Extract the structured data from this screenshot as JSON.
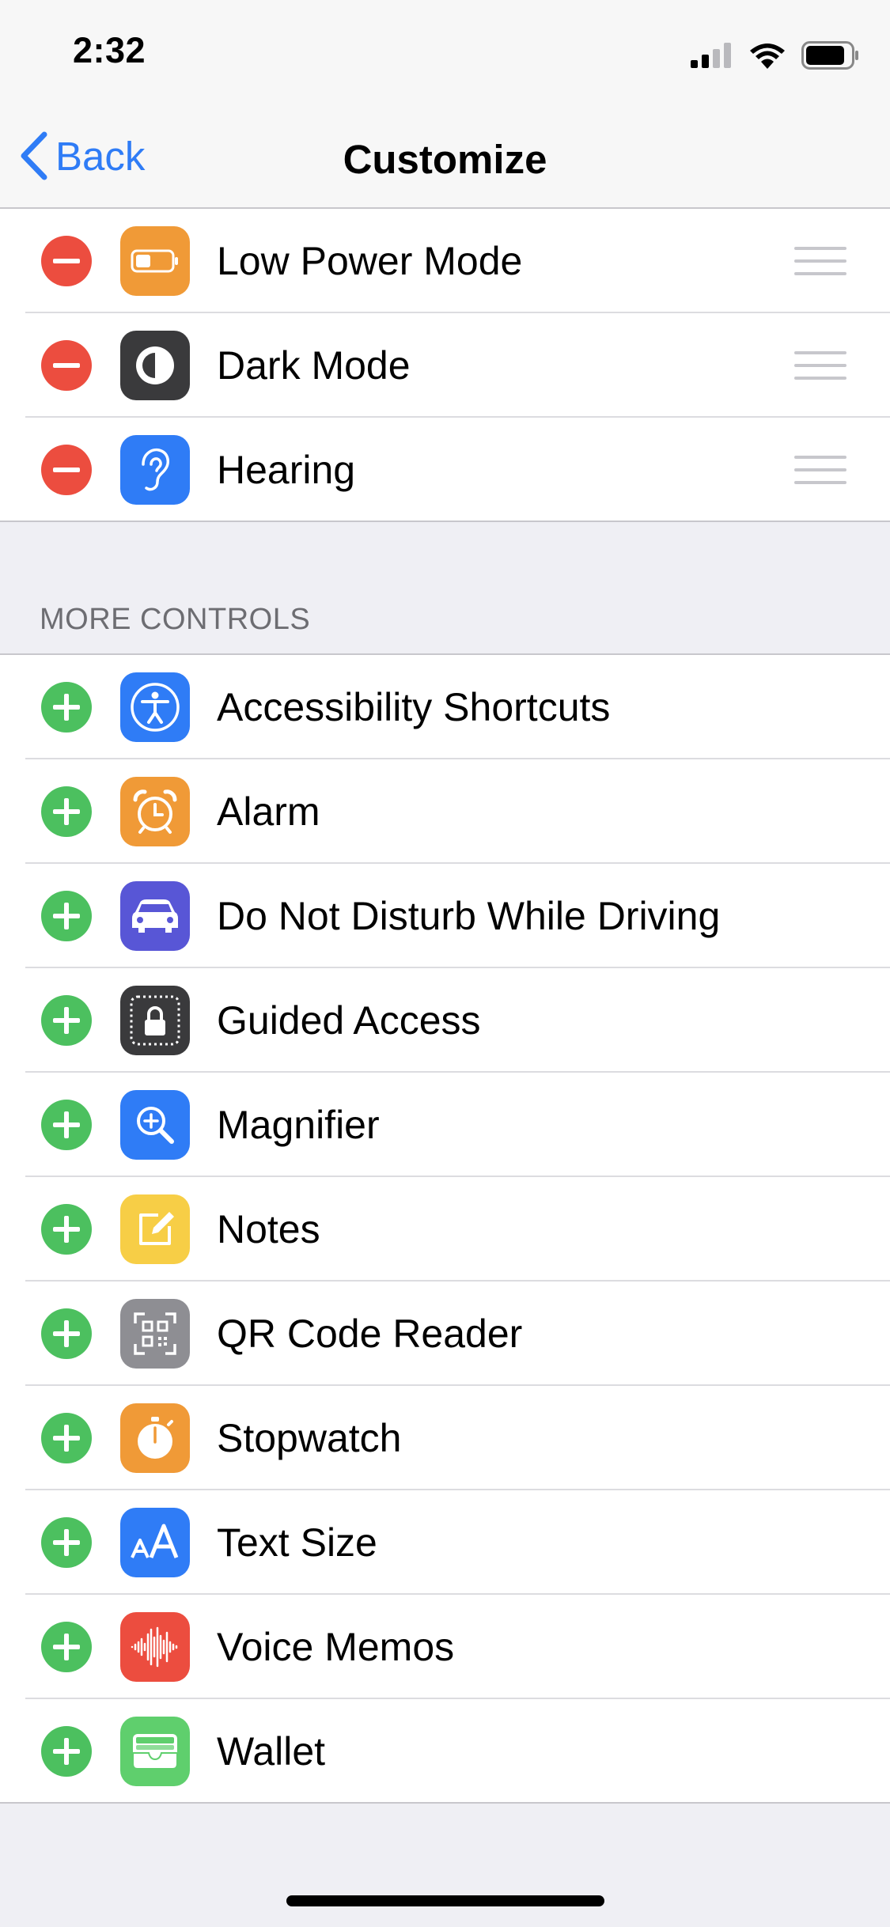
{
  "status": {
    "time": "2:32"
  },
  "nav": {
    "back_label": "Back",
    "title": "Customize"
  },
  "included": [
    {
      "label": "Low Power Mode",
      "icon": "battery-icon",
      "color": "#f09a37"
    },
    {
      "label": "Dark Mode",
      "icon": "dark-mode-icon",
      "color": "#3a3a3c"
    },
    {
      "label": "Hearing",
      "icon": "ear-icon",
      "color": "#2f7cf6"
    }
  ],
  "more_controls": {
    "header": "MORE CONTROLS",
    "items": [
      {
        "label": "Accessibility Shortcuts",
        "icon": "accessibility-icon",
        "color": "#2f7cf6"
      },
      {
        "label": "Alarm",
        "icon": "alarm-clock-icon",
        "color": "#f09a37"
      },
      {
        "label": "Do Not Disturb While Driving",
        "icon": "car-icon",
        "color": "#5856d6"
      },
      {
        "label": "Guided Access",
        "icon": "lock-icon",
        "color": "#3a3a3c"
      },
      {
        "label": "Magnifier",
        "icon": "magnifier-icon",
        "color": "#2f7cf6"
      },
      {
        "label": "Notes",
        "icon": "notes-icon",
        "color": "#f7ce46"
      },
      {
        "label": "QR Code Reader",
        "icon": "qr-code-icon",
        "color": "#8e8e93"
      },
      {
        "label": "Stopwatch",
        "icon": "stopwatch-icon",
        "color": "#f09a37"
      },
      {
        "label": "Text Size",
        "icon": "text-size-icon",
        "color": "#2f7cf6"
      },
      {
        "label": "Voice Memos",
        "icon": "voice-memos-icon",
        "color": "#ec4d3f"
      },
      {
        "label": "Wallet",
        "icon": "wallet-icon",
        "color": "#5fcf6d"
      }
    ]
  },
  "colors": {
    "accent": "#2f7cf6",
    "remove": "#ec4d3f",
    "add": "#4cc05f"
  }
}
